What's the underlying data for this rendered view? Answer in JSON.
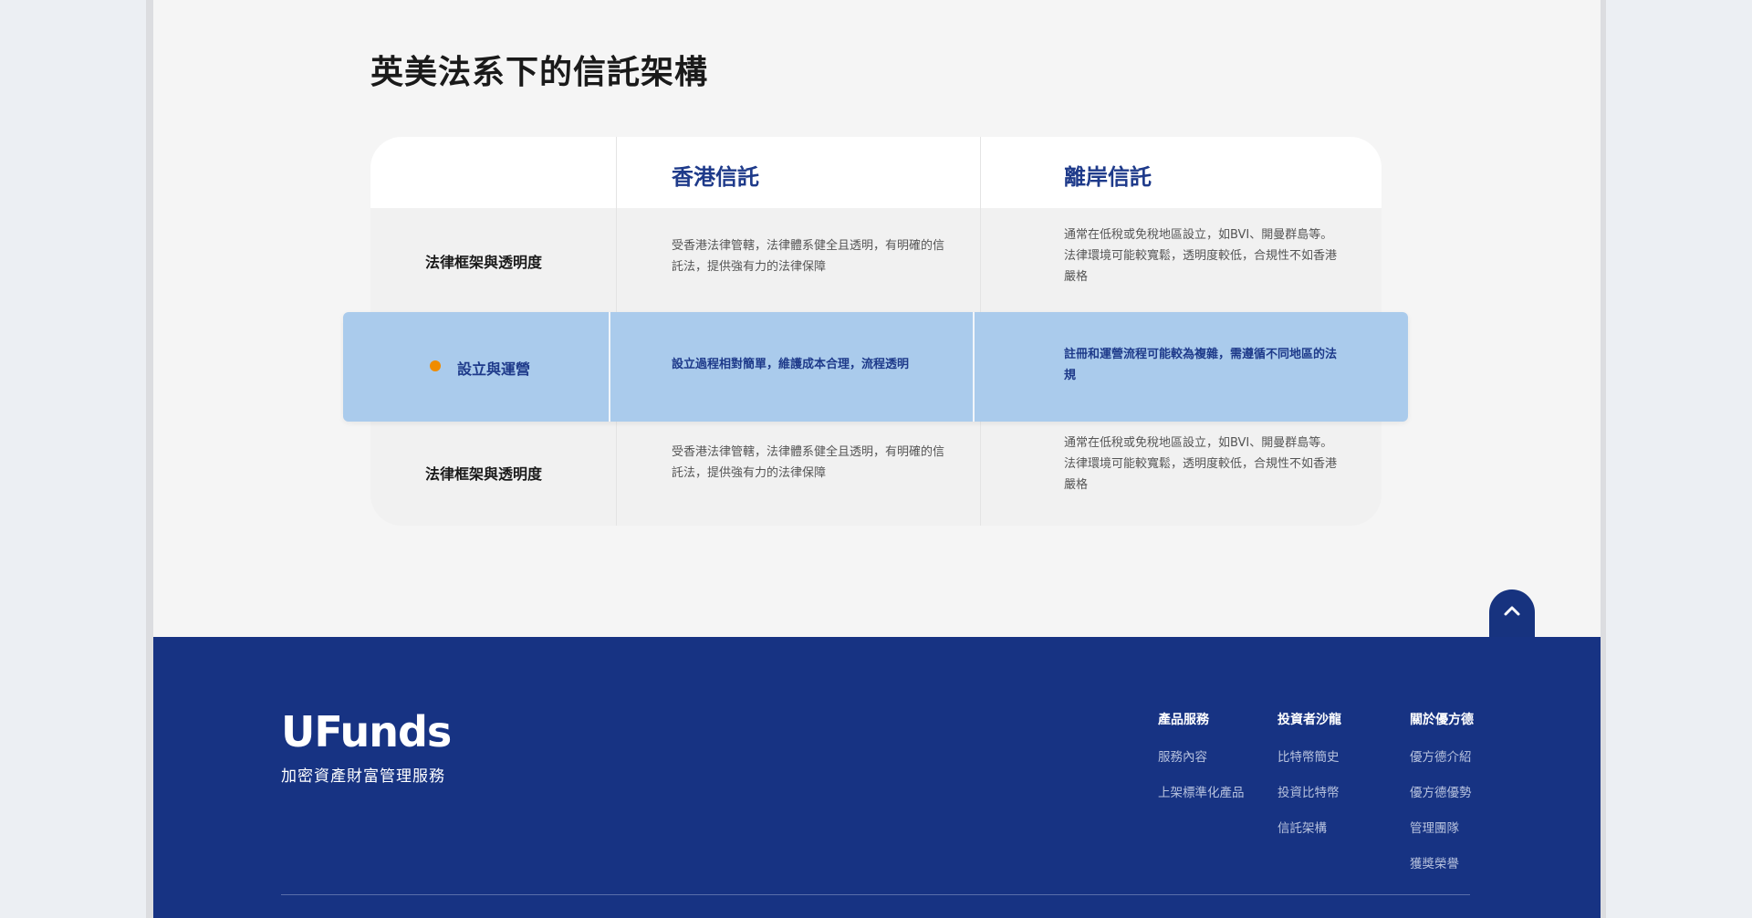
{
  "section": {
    "title": "英美法系下的信託架構"
  },
  "table": {
    "headers": [
      "",
      "香港信託",
      "離岸信託"
    ],
    "rows": [
      {
        "label": "法律框架與透明度",
        "hk": "受香港法律管轄，法律體系健全且透明，有明確的信託法，提供強有力的法律保障",
        "offshore": "通常在低稅或免稅地區設立，如BVI、開曼群島等。法律環境可能較寬鬆，透明度較低，合規性不如香港嚴格"
      },
      {
        "label": "設立與運營",
        "hk": "設立過程相對簡單，維護成本合理，流程透明",
        "offshore": "註冊和運營流程可能較為複雜，需遵循不同地區的法規",
        "highlighted": true
      },
      {
        "label": "法律框架與透明度",
        "hk": "受香港法律管轄，法律體系健全且透明，有明確的信託法，提供強有力的法律保障",
        "offshore": "通常在低稅或免稅地區設立，如BVI、開曼群島等。法律環境可能較寬鬆，透明度較低，合規性不如香港嚴格"
      }
    ]
  },
  "footer": {
    "logo_text": "UFunds",
    "tagline": "加密資產財富管理服務",
    "columns": [
      {
        "heading": "產品服務",
        "links": [
          "服務內容",
          "上架標準化產品"
        ]
      },
      {
        "heading": "投資者沙龍",
        "links": [
          "比特幣簡史",
          "投資比特幣",
          "信託架構"
        ]
      },
      {
        "heading": "關於優方德",
        "links": [
          "優方德介紹",
          "優方德優勢",
          "管理團隊",
          "獲獎榮譽"
        ]
      }
    ]
  },
  "colors": {
    "brand_navy": "#173383",
    "highlight": "#aacbec",
    "accent_dot": "#f08c00",
    "heading_blue": "#1e3a8a"
  },
  "icons": {
    "scroll_top": "chevron-up-icon"
  }
}
